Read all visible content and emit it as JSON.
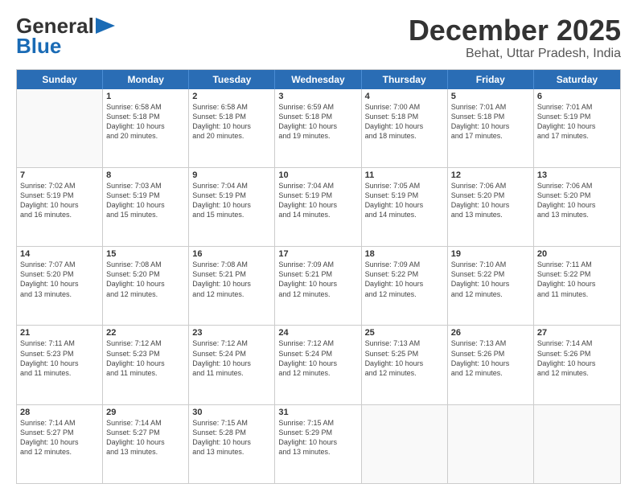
{
  "header": {
    "logo_general": "General",
    "logo_blue": "Blue",
    "month": "December 2025",
    "location": "Behat, Uttar Pradesh, India"
  },
  "weekdays": [
    "Sunday",
    "Monday",
    "Tuesday",
    "Wednesday",
    "Thursday",
    "Friday",
    "Saturday"
  ],
  "weeks": [
    [
      {
        "day": "",
        "info": ""
      },
      {
        "day": "1",
        "info": "Sunrise: 6:58 AM\nSunset: 5:18 PM\nDaylight: 10 hours\nand 20 minutes."
      },
      {
        "day": "2",
        "info": "Sunrise: 6:58 AM\nSunset: 5:18 PM\nDaylight: 10 hours\nand 20 minutes."
      },
      {
        "day": "3",
        "info": "Sunrise: 6:59 AM\nSunset: 5:18 PM\nDaylight: 10 hours\nand 19 minutes."
      },
      {
        "day": "4",
        "info": "Sunrise: 7:00 AM\nSunset: 5:18 PM\nDaylight: 10 hours\nand 18 minutes."
      },
      {
        "day": "5",
        "info": "Sunrise: 7:01 AM\nSunset: 5:18 PM\nDaylight: 10 hours\nand 17 minutes."
      },
      {
        "day": "6",
        "info": "Sunrise: 7:01 AM\nSunset: 5:19 PM\nDaylight: 10 hours\nand 17 minutes."
      }
    ],
    [
      {
        "day": "7",
        "info": "Sunrise: 7:02 AM\nSunset: 5:19 PM\nDaylight: 10 hours\nand 16 minutes."
      },
      {
        "day": "8",
        "info": "Sunrise: 7:03 AM\nSunset: 5:19 PM\nDaylight: 10 hours\nand 15 minutes."
      },
      {
        "day": "9",
        "info": "Sunrise: 7:04 AM\nSunset: 5:19 PM\nDaylight: 10 hours\nand 15 minutes."
      },
      {
        "day": "10",
        "info": "Sunrise: 7:04 AM\nSunset: 5:19 PM\nDaylight: 10 hours\nand 14 minutes."
      },
      {
        "day": "11",
        "info": "Sunrise: 7:05 AM\nSunset: 5:19 PM\nDaylight: 10 hours\nand 14 minutes."
      },
      {
        "day": "12",
        "info": "Sunrise: 7:06 AM\nSunset: 5:20 PM\nDaylight: 10 hours\nand 13 minutes."
      },
      {
        "day": "13",
        "info": "Sunrise: 7:06 AM\nSunset: 5:20 PM\nDaylight: 10 hours\nand 13 minutes."
      }
    ],
    [
      {
        "day": "14",
        "info": "Sunrise: 7:07 AM\nSunset: 5:20 PM\nDaylight: 10 hours\nand 13 minutes."
      },
      {
        "day": "15",
        "info": "Sunrise: 7:08 AM\nSunset: 5:20 PM\nDaylight: 10 hours\nand 12 minutes."
      },
      {
        "day": "16",
        "info": "Sunrise: 7:08 AM\nSunset: 5:21 PM\nDaylight: 10 hours\nand 12 minutes."
      },
      {
        "day": "17",
        "info": "Sunrise: 7:09 AM\nSunset: 5:21 PM\nDaylight: 10 hours\nand 12 minutes."
      },
      {
        "day": "18",
        "info": "Sunrise: 7:09 AM\nSunset: 5:22 PM\nDaylight: 10 hours\nand 12 minutes."
      },
      {
        "day": "19",
        "info": "Sunrise: 7:10 AM\nSunset: 5:22 PM\nDaylight: 10 hours\nand 12 minutes."
      },
      {
        "day": "20",
        "info": "Sunrise: 7:11 AM\nSunset: 5:22 PM\nDaylight: 10 hours\nand 11 minutes."
      }
    ],
    [
      {
        "day": "21",
        "info": "Sunrise: 7:11 AM\nSunset: 5:23 PM\nDaylight: 10 hours\nand 11 minutes."
      },
      {
        "day": "22",
        "info": "Sunrise: 7:12 AM\nSunset: 5:23 PM\nDaylight: 10 hours\nand 11 minutes."
      },
      {
        "day": "23",
        "info": "Sunrise: 7:12 AM\nSunset: 5:24 PM\nDaylight: 10 hours\nand 11 minutes."
      },
      {
        "day": "24",
        "info": "Sunrise: 7:12 AM\nSunset: 5:24 PM\nDaylight: 10 hours\nand 12 minutes."
      },
      {
        "day": "25",
        "info": "Sunrise: 7:13 AM\nSunset: 5:25 PM\nDaylight: 10 hours\nand 12 minutes."
      },
      {
        "day": "26",
        "info": "Sunrise: 7:13 AM\nSunset: 5:26 PM\nDaylight: 10 hours\nand 12 minutes."
      },
      {
        "day": "27",
        "info": "Sunrise: 7:14 AM\nSunset: 5:26 PM\nDaylight: 10 hours\nand 12 minutes."
      }
    ],
    [
      {
        "day": "28",
        "info": "Sunrise: 7:14 AM\nSunset: 5:27 PM\nDaylight: 10 hours\nand 12 minutes."
      },
      {
        "day": "29",
        "info": "Sunrise: 7:14 AM\nSunset: 5:27 PM\nDaylight: 10 hours\nand 13 minutes."
      },
      {
        "day": "30",
        "info": "Sunrise: 7:15 AM\nSunset: 5:28 PM\nDaylight: 10 hours\nand 13 minutes."
      },
      {
        "day": "31",
        "info": "Sunrise: 7:15 AM\nSunset: 5:29 PM\nDaylight: 10 hours\nand 13 minutes."
      },
      {
        "day": "",
        "info": ""
      },
      {
        "day": "",
        "info": ""
      },
      {
        "day": "",
        "info": ""
      }
    ]
  ]
}
